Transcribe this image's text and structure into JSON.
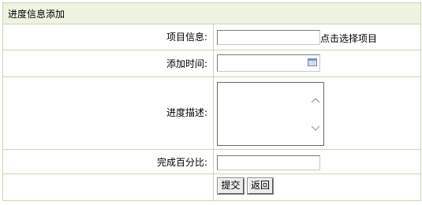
{
  "title": "进度信息添加",
  "fields": {
    "project": {
      "label": "项目信息:",
      "value": "",
      "hint": "点击选择项目"
    },
    "add_time": {
      "label": "添加时间:",
      "value": ""
    },
    "description": {
      "label": "进度描述:",
      "value": ""
    },
    "percent": {
      "label": "完成百分比:",
      "value": ""
    }
  },
  "buttons": {
    "submit": "提交",
    "back": "返回"
  },
  "icons": [
    "calendar-icon",
    "scroll-up-icon",
    "scroll-down-icon"
  ],
  "colors": {
    "border": "#c8d8b0",
    "title_bg": "#eef3e2"
  }
}
